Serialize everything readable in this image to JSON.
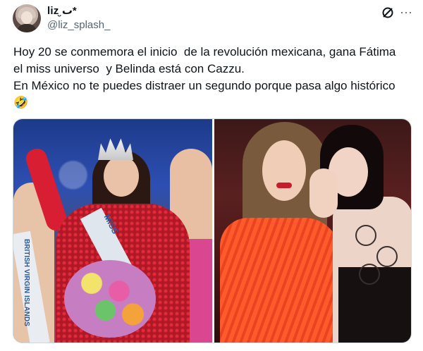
{
  "user": {
    "name": "liz ٮ̮*",
    "handle": "@liz_splash_"
  },
  "actions": {
    "grok_icon": "grok-icon",
    "more_icon": "more-icon",
    "more_glyph": "···"
  },
  "tweet": {
    "text": "Hoy 20 se conmemora el inicio  de la revolución mexicana, gana Fátima\nel miss universo  y Belinda está con Cazzu.\nEn México no te puedes distraer un segundo porque pasa algo histórico\n🤣"
  },
  "media": {
    "left_sash_text": "MISS",
    "left_girl_sash_text": "BRITISH VIRGIN ISLANDS"
  },
  "colors": {
    "handle": "#536471",
    "border": "#cfd9de",
    "text": "#0f1419"
  }
}
